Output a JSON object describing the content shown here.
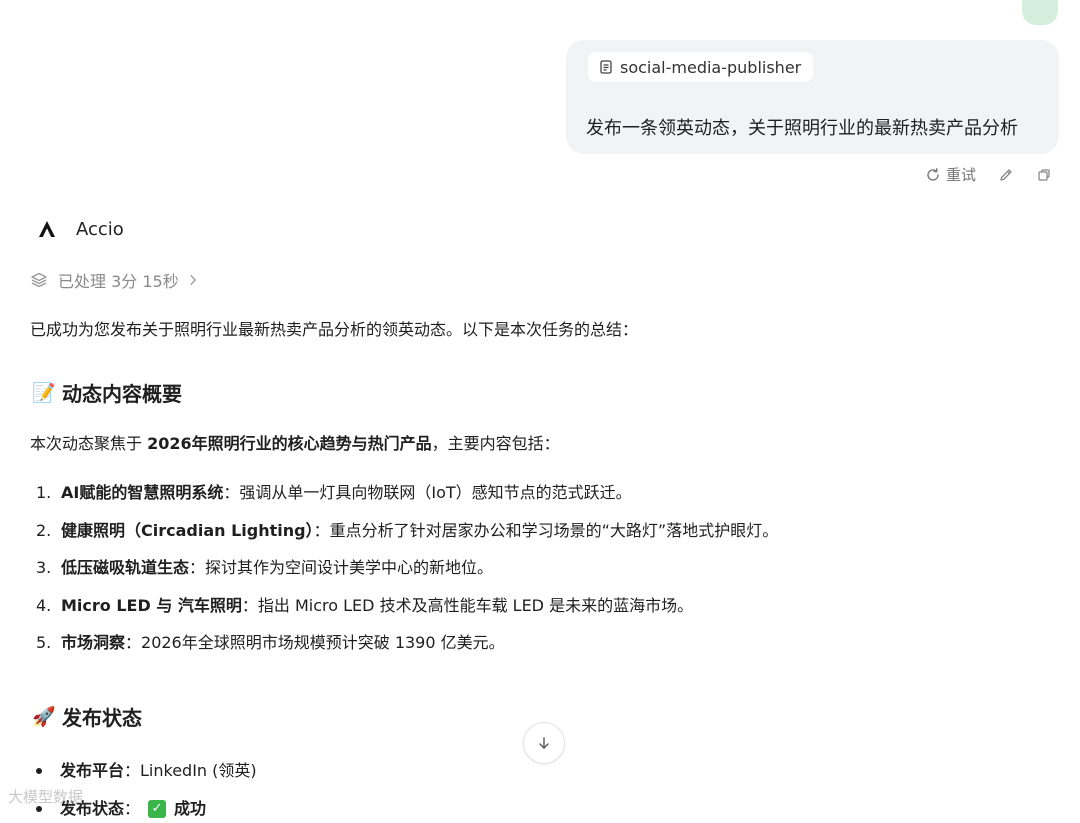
{
  "user_message": {
    "skill_chip": "social-media-publisher",
    "text": "发布一条领英动态，关于照明行业的最新热卖产品分析"
  },
  "message_actions": {
    "retry_label": "重试",
    "edit_icon": "pencil-icon",
    "copy_icon": "copy-icon"
  },
  "assistant": {
    "name": "Accio",
    "processed": "已处理 3分 15秒"
  },
  "response": {
    "intro": "已成功为您发布关于照明行业最新热卖产品分析的领英动态。以下是本次任务的总结：",
    "section1": {
      "emoji": "📝",
      "title": "动态内容概要",
      "para_prefix": "本次动态聚焦于 ",
      "para_bold": "2026年照明行业的核心趋势与热门产品",
      "para_suffix": "，主要内容包括：",
      "items": [
        {
          "num": "1.",
          "bold": "AI赋能的智慧照明系统",
          "text": "：强调从单一灯具向物联网（IoT）感知节点的范式跃迁。"
        },
        {
          "num": "2.",
          "bold": "健康照明（Circadian Lighting）",
          "text": "：重点分析了针对居家办公和学习场景的“大路灯”落地式护眼灯。"
        },
        {
          "num": "3.",
          "bold": "低压磁吸轨道生态",
          "text": "：探讨其作为空间设计美学中心的新地位。"
        },
        {
          "num": "4.",
          "bold": "Micro LED 与 汽车照明",
          "text": "：指出 Micro LED 技术及高性能车载 LED 是未来的蓝海市场。"
        },
        {
          "num": "5.",
          "bold": "市场洞察",
          "text": "：2026年全球照明市场规模预计突破 1390 亿美元。"
        }
      ]
    },
    "section2": {
      "emoji": "🚀",
      "title": "发布状态",
      "items": [
        {
          "bold": "发布平台",
          "text": "：LinkedIn (领英)"
        },
        {
          "bold": "发布状态",
          "text": "：",
          "check": "✓",
          "status": "成功"
        }
      ]
    }
  },
  "watermark": "大模型数据"
}
